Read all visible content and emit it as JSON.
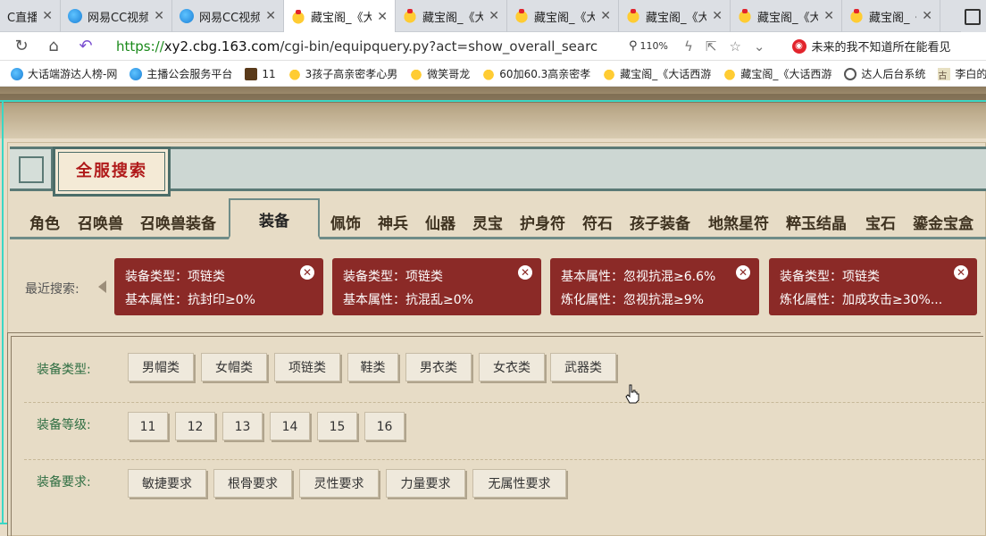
{
  "browser": {
    "tabs": [
      {
        "title": "C直播",
        "icon": "cc-icon",
        "active": false
      },
      {
        "title": "网易CC视频",
        "icon": "cc-icon",
        "active": false
      },
      {
        "title": "网易CC视频",
        "icon": "cc-icon",
        "active": false
      },
      {
        "title": "藏宝阁_《大",
        "icon": "chick-icon",
        "active": true
      },
      {
        "title": "藏宝阁_《大",
        "icon": "chick-icon",
        "active": false
      },
      {
        "title": "藏宝阁_《大",
        "icon": "chick-icon",
        "active": false
      },
      {
        "title": "藏宝阁_《大",
        "icon": "chick-icon",
        "active": false
      },
      {
        "title": "藏宝阁_《大",
        "icon": "chick-icon",
        "active": false
      },
      {
        "title": "藏宝阁_《大",
        "icon": "chick-icon",
        "active": false
      }
    ],
    "url_proto": "https://",
    "url_host": "xy2.cbg.163.com",
    "url_path": "/cgi-bin/equipquery.py?act=show_overall_search_equip",
    "zoom": "110%",
    "news_text": "未来的我不知道所在能看见"
  },
  "bookmarks": [
    {
      "label": "大话端游达人榜-网",
      "icon": "cc-icon"
    },
    {
      "label": "主播公会服务平台",
      "icon": "cc-icon"
    },
    {
      "label": "11",
      "icon": "game-icon"
    },
    {
      "label": "3孩子高亲密孝心男",
      "icon": "chick-icon"
    },
    {
      "label": "微笑哥龙",
      "icon": "chick-icon"
    },
    {
      "label": "60加60.3高亲密孝",
      "icon": "chick-icon"
    },
    {
      "label": "藏宝阁_《大话西游",
      "icon": "chick-icon"
    },
    {
      "label": "藏宝阁_《大话西游",
      "icon": "chick-icon"
    },
    {
      "label": "达人后台系统",
      "icon": "globe-icon"
    },
    {
      "label": "李白的诗",
      "icon": "gu-icon"
    }
  ],
  "page": {
    "title": "全服搜索",
    "categories": [
      "角色",
      "召唤兽",
      "召唤兽装备",
      "装备",
      "佩饰",
      "神兵",
      "仙器",
      "灵宝",
      "护身符",
      "符石",
      "孩子装备",
      "地煞星符",
      "粹玉结晶",
      "宝石",
      "鎏金宝盒"
    ],
    "active_category": "装备",
    "recent_label": "最近搜索:",
    "recent_searches": [
      {
        "line1": "装备类型：项链类",
        "line2": "基本属性：抗封印≥0%"
      },
      {
        "line1": "装备类型：项链类",
        "line2": "基本属性：抗混乱≥0%"
      },
      {
        "line1": "基本属性：忽视抗混≥6.6%",
        "line2": "炼化属性：忽视抗混≥9%"
      },
      {
        "line1": "装备类型：项链类",
        "line2": "炼化属性：加成攻击≥30%..."
      }
    ],
    "filters": {
      "type_label": "装备类型:",
      "types": [
        "男帽类",
        "女帽类",
        "项链类",
        "鞋类",
        "男衣类",
        "女衣类",
        "武器类"
      ],
      "level_label": "装备等级:",
      "levels": [
        "11",
        "12",
        "13",
        "14",
        "15",
        "16"
      ],
      "req_label": "装备要求:",
      "requirements": [
        "敏捷要求",
        "根骨要求",
        "灵性要求",
        "力量要求",
        "无属性要求"
      ]
    }
  },
  "colors": {
    "chip_bg": "#8b2a27",
    "frame_cyan": "#3ad7c5",
    "label_green": "#2f6e42",
    "title_red": "#b01a1a"
  }
}
